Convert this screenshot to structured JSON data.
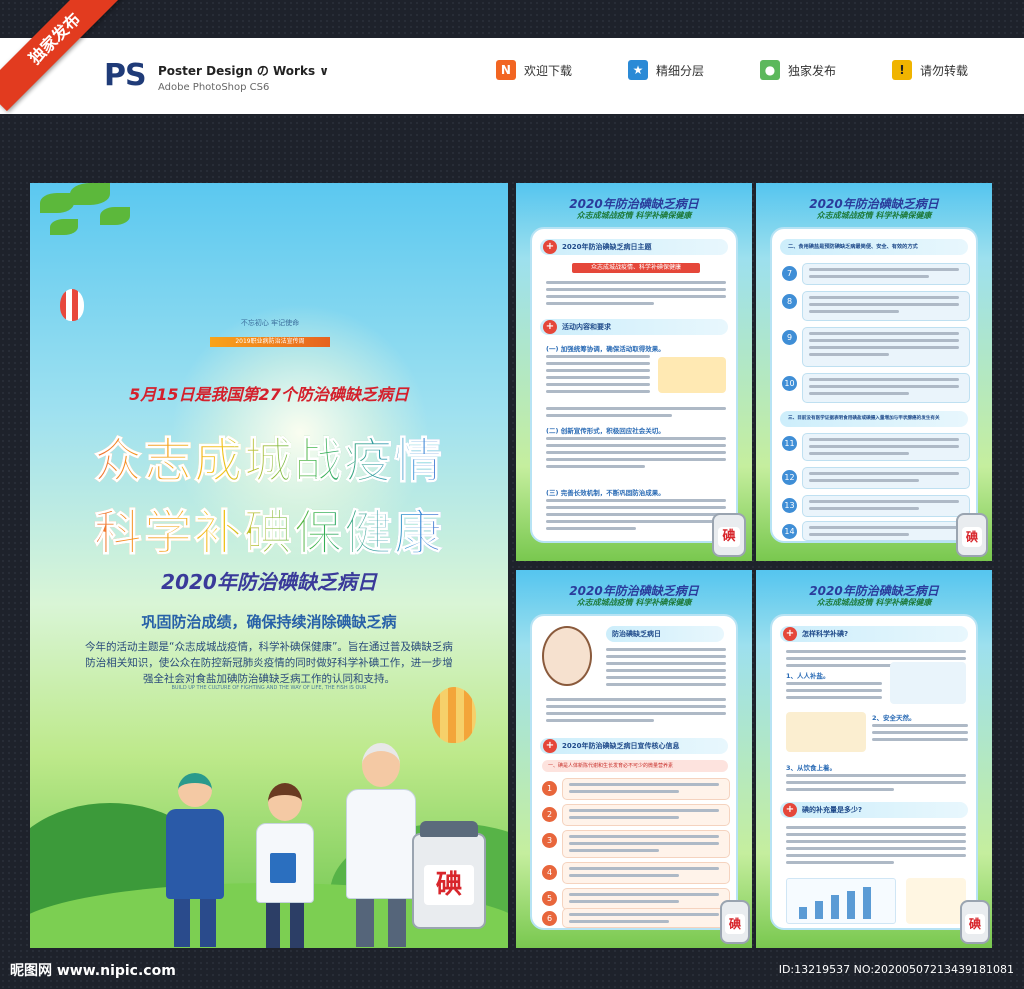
{
  "ribbon": "独家发布",
  "header": {
    "logo": "PS",
    "title": "Poster Design の Works ∨",
    "subtitle": "Adobe PhotoShop CS6",
    "nav": [
      {
        "label": "欢迎下载",
        "icon": "n-icon",
        "color": "#f26522",
        "glyph": "N"
      },
      {
        "label": "精细分层",
        "icon": "star-icon",
        "color": "#2b8ad6",
        "glyph": "★"
      },
      {
        "label": "独家发布",
        "icon": "user-icon",
        "color": "#5cb85c",
        "glyph": "●"
      },
      {
        "label": "请勿转载",
        "icon": "warning-icon",
        "color": "#f0b400",
        "glyph": "!"
      }
    ]
  },
  "main_poster": {
    "top_small": "不忘初心 牢记使命",
    "year_bar": "2019职业病防治法宣传周",
    "date_line": "5月15日是我国第27个防治碘缺乏病日",
    "title_line1": "众志成城战疫情",
    "title_line2": "科学补碘保健康",
    "subtitle": "2020年防治碘缺乏病日",
    "slogan": "巩固防治成绩，确保持续消除碘缺乏病",
    "body": "今年的活动主题是“众志成城战疫情，科学补碘保健康”。旨在通过普及碘缺乏病防治相关知识，使公众在防控新冠肺炎疫情的同时做好科学补碘工作，进一步增强全社会对食盐加碘防治碘缺乏病工作的认同和支持。",
    "tiny_en": "BUILD UP THE CULTURE OF FIGHTING AND THE WAY OF LIFE, THE FISH IS OUR",
    "jar_label": "碘"
  },
  "panel_common": {
    "title": "2020年防治碘缺乏病日",
    "sub": "众志成城战疫情 科学补碘保健康",
    "jar_label": "碘"
  },
  "panel1": {
    "h1": "2020年防治碘缺乏病日主题",
    "red_bar": "众志成城战疫情、科学补碘保健康",
    "h2": "活动内容和要求",
    "s1": "(一) 加强统筹协调，确保活动取得效果。",
    "s2": "(二) 创新宣传形式，积极回应社会关切。",
    "s3": "(三) 完善长效机制，不断巩固防治成果。"
  },
  "panel2": {
    "h1": "二、食用碘盐是预防碘缺乏病最简便、安全、有效的方式",
    "nums1": [
      "7",
      "8",
      "9",
      "10"
    ],
    "h2": "三、目前没有医学证据表明食用碘盐或碘摄入量增加与甲状腺癌的发生有关",
    "nums2": [
      "11",
      "12",
      "13",
      "14"
    ]
  },
  "panel3": {
    "h1": "防治碘缺乏病日",
    "h2": "2020年防治碘缺乏病日宣传核心信息",
    "h3": "一、碘是人体新陈代谢和生长发育必不可少的微量营养素",
    "nums": [
      "1",
      "2",
      "3",
      "4",
      "5",
      "6"
    ]
  },
  "panel4": {
    "h1": "怎样科学补碘?",
    "s1": "1、人人补盐。",
    "s2": "2、安全天然。",
    "s3": "3、从饮食上着。",
    "h2": "碘的补充量是多少?"
  },
  "footer": {
    "logo": "昵图网 www.nipic.com",
    "id": "ID:13219537 NO:20200507213439181081"
  }
}
